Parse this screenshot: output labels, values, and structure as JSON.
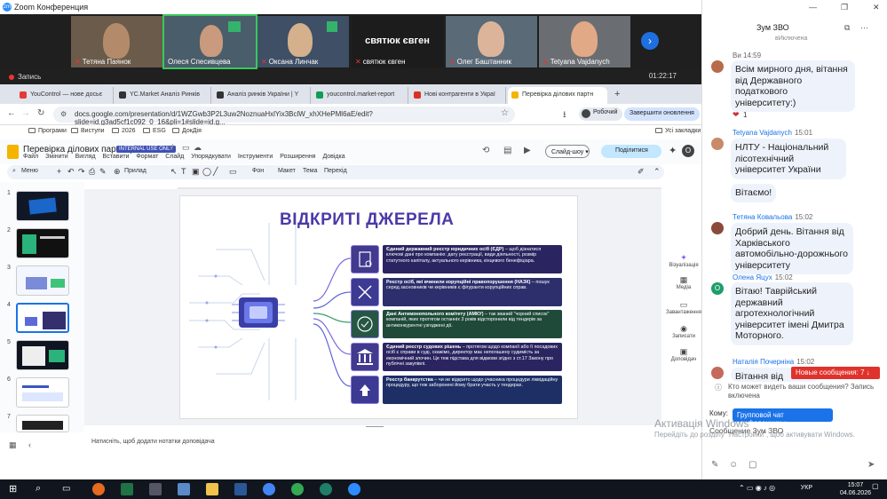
{
  "zoom": {
    "title": "Zoom Конференция"
  },
  "participants": [
    {
      "name": "Тетяна Паянок",
      "muted": true
    },
    {
      "name": "Олеся Спесивцева",
      "muted": false
    },
    {
      "name": "Оксана Линчак",
      "muted": true
    },
    {
      "name": "святюк євген",
      "muted": true,
      "display_name": "святюк євген"
    },
    {
      "name": "Олег Баштанник",
      "muted": true
    },
    {
      "name": "Tetyana Vajdanych",
      "muted": true
    }
  ],
  "recording": {
    "label": "Запись",
    "time": "01:22:17"
  },
  "browser": {
    "tabs": [
      {
        "label": "YouControl — нове досьє",
        "color": "#e53935"
      },
      {
        "label": "YC.Market Аналіз Ринків",
        "color": "#333333"
      },
      {
        "label": "Аналіз ринків України | Y",
        "color": "#333333"
      },
      {
        "label": "youcontrol.market-report",
        "color": "#0f9d58"
      },
      {
        "label": "Нові контрагенти в Украї",
        "color": "#d93025"
      },
      {
        "label": "Перевірка ділових партн",
        "color": "#f4b400"
      }
    ],
    "url": "docs.google.com/presentation/d/1WZGwb3P2L3uw2NoznuaHxlYix3BclW_xhXHePMl6aE/edit?slide=id.g3ad5cf1c092_0_16&pli=1#slide=id.g...",
    "profile": "Робочий",
    "update_label": "Завершити оновлення",
    "bookmarks": [
      "Програми",
      "Виступи",
      "2026",
      "ESG",
      "ДокДія"
    ],
    "all_bookmarks": "Усі закладки"
  },
  "slides": {
    "doc_title": "Перевірка ділових партнерів",
    "badge": "INTERNAL USE ONLY",
    "menu": [
      "Файл",
      "Змінити",
      "Вигляд",
      "Вставити",
      "Формат",
      "Слайд",
      "Упорядкувати",
      "Інструменти",
      "Розширення",
      "Довідка"
    ],
    "slideshow": "Слайд-шоу",
    "share": "Поділитися",
    "avatar_letter": "O",
    "toolbar": [
      "Меню",
      "Прилад",
      "Фон",
      "Макет",
      "Тема",
      "Перехід"
    ],
    "slide_numbers": [
      "1",
      "2",
      "3",
      "4",
      "5",
      "6",
      "7"
    ],
    "notes_placeholder": "Натисніть, щоб додати нотатки доповідача",
    "side_tools": [
      "Візуалізація",
      "Медіа",
      "Завантаження",
      "Записати",
      "Доповідач"
    ]
  },
  "slide": {
    "title": "ВІДКРИТІ ДЖЕРЕЛА",
    "items": [
      {
        "bold": "Єдиний державний реєстр юридичних осіб (ЄДР)",
        "text": " – щоб дізнатися ключові дані про компанію: дату реєстрації, види діяльності, розмір статутного капіталу, актуального керівника, кінцевого бенефіціара.",
        "color": "#2a2560"
      },
      {
        "bold": "Реєстр осіб, які вчинили корупційні правопорушення (НАЗК)",
        "text": " – пошук серед засновників чи керівників є фігуранти корупційних справ.",
        "color": "#2c2f6b"
      },
      {
        "bold": "Дані Антимонопольного комітету (АМКУ)",
        "text": " – так званий \"чорний список\" компаній, яких протягом останніх 3 років відсторонили від тендерів за антиконкурентні узгоджені дії.",
        "color": "#1f4a3a"
      },
      {
        "bold": "Єдиний реєстр судових рішень",
        "text": " – протягом щодо компанії або її посадових осіб є справи в суді, скажімо, директор має непогашену судимість за економічний злочин. Це теж підстава для відмови згідно з ст.17 Закону про публічні закупівлі.",
        "color": "#2a2560"
      },
      {
        "bold": "Реєстр банкрутства",
        "text": " – чи не відкрито щодо учасника процедури ліквідаційну процедуру, що теж заборонені йому брати участь у тендерах.",
        "color": "#1e2f66"
      }
    ]
  },
  "chat": {
    "title": "Зум ЗВО",
    "messages_header": "вИключена",
    "messages": [
      {
        "author": "Ви",
        "time": "14:59",
        "text": "Всім мирного дня, вітання від Державного податкового університету:)",
        "reaction": "1"
      },
      {
        "author": "Tetyana Vajdanych",
        "time": "15:01",
        "text": "НЛТУ - Національний лісотехнічний університет України"
      },
      {
        "author": "",
        "time": "",
        "text": "Вітаємо!"
      },
      {
        "author": "Тетяна Ковальова",
        "time": "15:02",
        "text": "Добрий день. Вітання від Харківського автомобільно-дорожнього університету"
      },
      {
        "author": "Олена Яцух",
        "time": "15:02",
        "text": "Вітаю! Таврійський державний агротехнологічний університет імені Дмитра Моторного."
      },
      {
        "author": "Наталія Почерніна",
        "time": "15:02",
        "text": "Вітання від Таврійського"
      }
    ],
    "new_messages": "Новые сообщения: 7",
    "privacy": "Кто может видеть ваши сообщения? Запись включена",
    "to_label": "Кому:",
    "to_value": "Групповой чат конференции",
    "input_placeholder": "Сообщение Зум ЗВО"
  },
  "windows_activation": {
    "title": "Активація Windows",
    "text": "Перейдіть до розділу \"Настройки\", щоб активувати Windows."
  },
  "taskbar": {
    "lang": "УКР",
    "time": "15:07",
    "date": "04.06.2026"
  }
}
